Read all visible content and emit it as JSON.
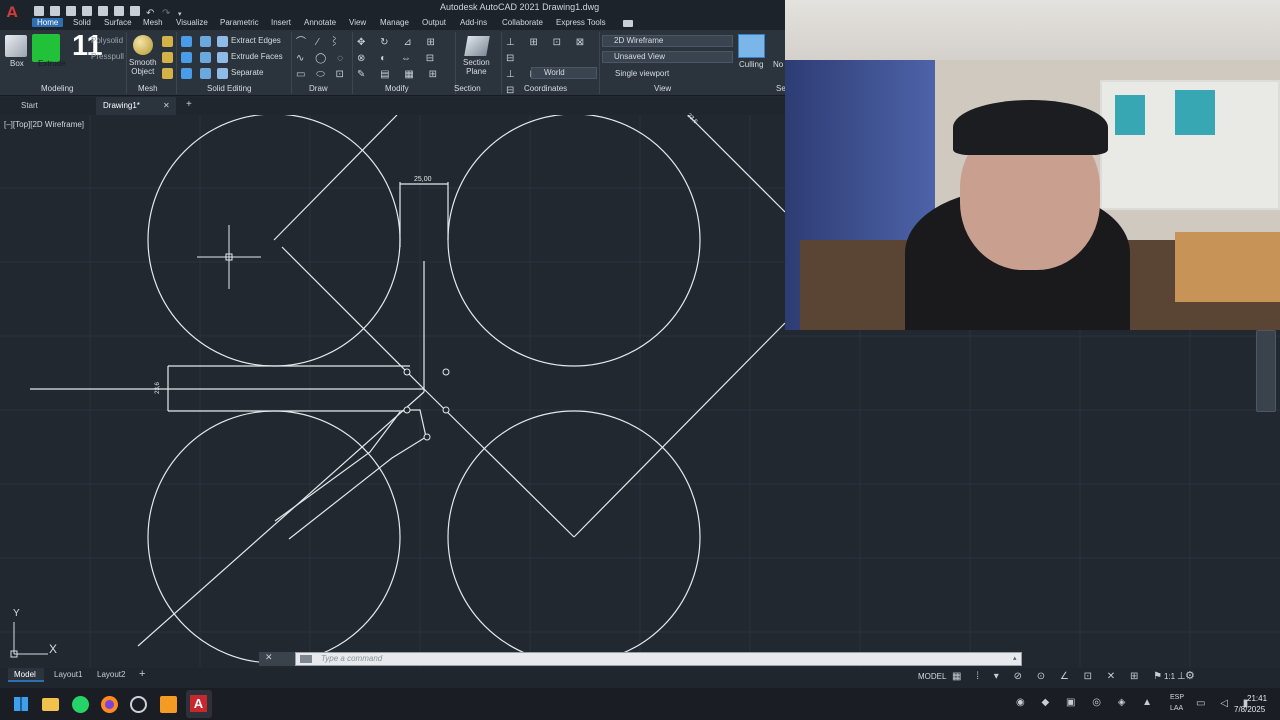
{
  "window": {
    "title": "Autodesk AutoCAD 2021   Drawing1.dwg",
    "logo_letter": "A"
  },
  "menu_tabs": [
    "Home",
    "Solid",
    "Surface",
    "Mesh",
    "Visualize",
    "Parametric",
    "Insert",
    "Annotate",
    "View",
    "Manage",
    "Output",
    "Add-ins",
    "Collaborate",
    "Express Tools"
  ],
  "ribbon": {
    "box_label": "Box",
    "extrude_label": "Extrude",
    "presspull_overlay": "11",
    "polysolid": "Polysolid",
    "presspull": "Presspull",
    "smooth_object": "Smooth\nObject",
    "extract_edges": "Extract Edges",
    "extrude_faces": "Extrude Faces",
    "separate": "Separate",
    "section_plane": "Section\nPlane",
    "visual_style": "2D Wireframe",
    "saved_view": "Unsaved View",
    "ucs": "World",
    "viewport": "Single viewport",
    "culling": "Culling",
    "no_label": "No",
    "se_label": "Se",
    "panels": {
      "modeling": "Modeling",
      "mesh": "Mesh",
      "solid_editing": "Solid Editing",
      "draw": "Draw",
      "modify": "Modify",
      "section": "Section",
      "coordinates": "Coordinates",
      "view": "View"
    }
  },
  "file_tabs": {
    "start": "Start",
    "drawing": "Drawing1*"
  },
  "viewport": {
    "label": "[–][Top][2D Wireframe]",
    "dim_top": "25,00",
    "dim_left": "23,6",
    "dim_corner": "23,6",
    "ucs_x": "X",
    "ucs_y": "Y"
  },
  "command": {
    "placeholder": "Type a command"
  },
  "layout_tabs": [
    "Model",
    "Layout1",
    "Layout2"
  ],
  "status": {
    "model": "MODEL",
    "scale": "1:1"
  },
  "taskbar": {
    "lang_top": "ESP",
    "lang_bottom": "LAA",
    "time": "21:41",
    "date": "7/8/2025"
  },
  "colors": {
    "accent": "#2d6fb1",
    "canvas": "#212830",
    "ribbon": "#2b333d",
    "cmd_bg": "#e7e9ec"
  }
}
